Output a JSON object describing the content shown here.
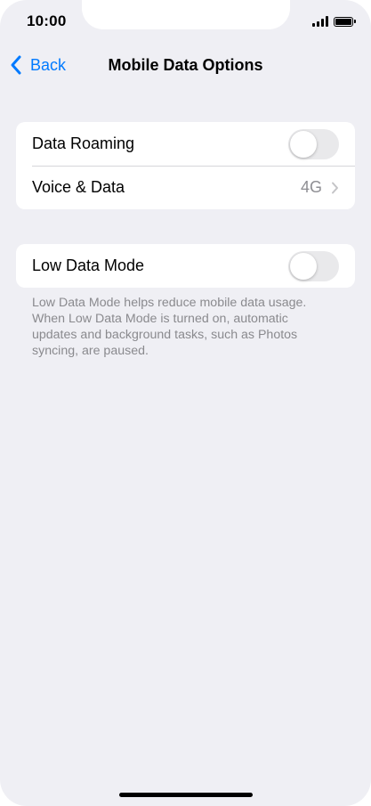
{
  "status_bar": {
    "time": "10:00"
  },
  "nav": {
    "back_label": "Back",
    "title": "Mobile Data Options"
  },
  "group1": {
    "rows": [
      {
        "label": "Data Roaming",
        "toggle_on": false
      },
      {
        "label": "Voice & Data",
        "value": "4G"
      }
    ]
  },
  "group2": {
    "rows": [
      {
        "label": "Low Data Mode",
        "toggle_on": false
      }
    ],
    "footer": "Low Data Mode helps reduce mobile data usage. When Low Data Mode is turned on, automatic updates and background tasks, such as Photos syncing, are paused."
  },
  "colors": {
    "accent": "#007aff",
    "background": "#efeff4",
    "toggle_off": "#e9e9eb"
  },
  "icons": [
    "signal-icon",
    "battery-icon",
    "back-chevron-icon",
    "chevron-right-icon"
  ]
}
